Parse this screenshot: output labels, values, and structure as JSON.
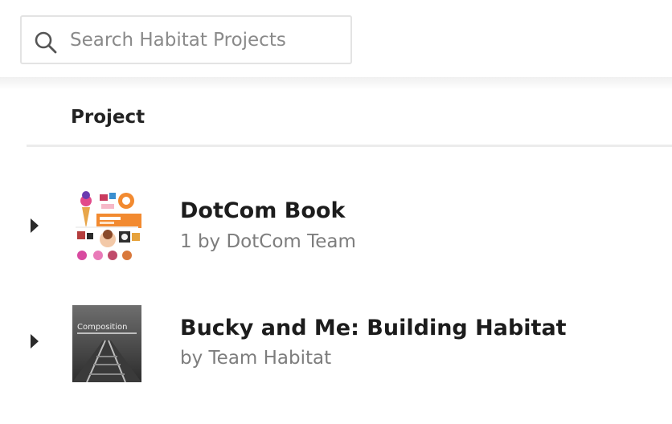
{
  "search": {
    "placeholder": "Search Habitat Projects",
    "value": ""
  },
  "table": {
    "column_header": "Project",
    "rows": [
      {
        "title": "DotCom Book",
        "meta": "1 by DotCom Team",
        "thumbnail": "book-cover-collage"
      },
      {
        "title": "Bucky and Me: Building Habitat",
        "meta": "by Team Habitat",
        "thumbnail": "book-cover-railroad",
        "cover_text": "Composition"
      }
    ]
  },
  "colors": {
    "text_primary": "#1c1c1c",
    "text_secondary": "#7d7d7d",
    "border": "#e3e3e3",
    "accent_orange": "#f28a30"
  }
}
